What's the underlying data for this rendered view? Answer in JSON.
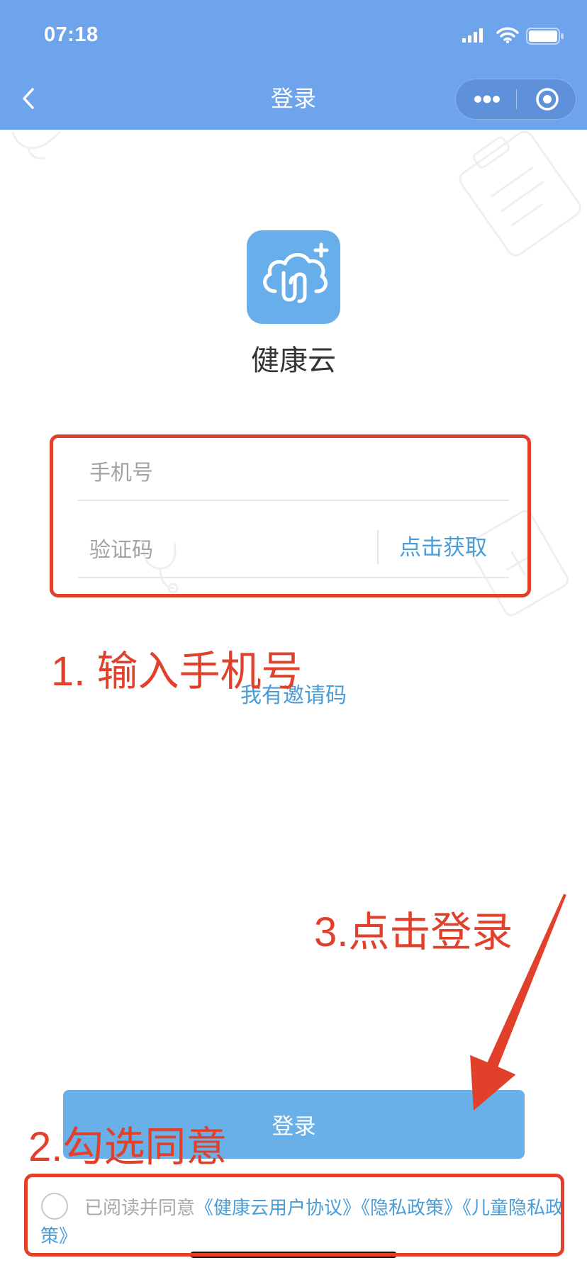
{
  "status_bar": {
    "time": "07:18",
    "icons": [
      "signal-icon",
      "wifi-icon",
      "battery-icon"
    ]
  },
  "nav": {
    "title": "登录",
    "back_icon": "chevron-left-icon",
    "more_icon": "more-dots-icon",
    "close_icon": "target-circle-icon"
  },
  "app": {
    "name": "健康云",
    "logo_icon": "cloud-plus-icon"
  },
  "form": {
    "phone_placeholder": "手机号",
    "code_placeholder": "验证码",
    "get_code_label": "点击获取",
    "invite_link": "我有邀请码"
  },
  "login_button": "登录",
  "agreement": {
    "prefix": "已阅读并同意",
    "links": [
      "《健康云用户协议》",
      "《隐私政策》",
      "《儿童隐私政策》"
    ],
    "checked": false
  },
  "annotations": {
    "step1": "1. 输入手机号",
    "step2": "2.勾选同意",
    "step3": "3.点击登录"
  },
  "colors": {
    "header": "#6ea4ec",
    "accent": "#4a9dd6",
    "button": "#6ab0e8",
    "annotation": "#e1412b",
    "logo": "#68aeea"
  }
}
